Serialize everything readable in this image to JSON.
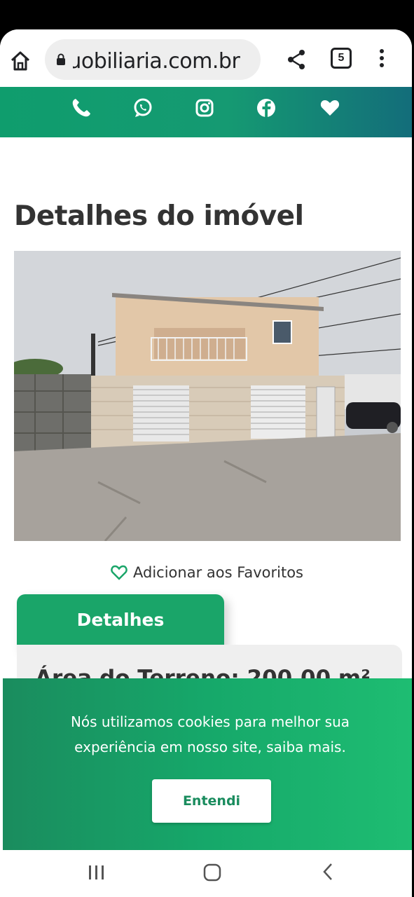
{
  "browser": {
    "url": "ɹobiliaria.com.br",
    "tab_count": "5",
    "icons": [
      "home-icon",
      "lock-icon",
      "share-icon",
      "tabs-icon",
      "more-vert-icon"
    ]
  },
  "social_bar": {
    "icons": [
      "phone-icon",
      "whatsapp-icon",
      "instagram-icon",
      "facebook-icon",
      "heart-icon"
    ],
    "color": "#159a72"
  },
  "page": {
    "title": "Detalhes do imóvel",
    "favorite_label": "Adicionar aos Favoritos",
    "tab_label": "Detalhes",
    "area_text": "Área do Terreno: 200,00 m²"
  },
  "cookie_banner": {
    "message": "Nós utilizamos cookies para melhor sua experiência em nosso site, saiba mais.",
    "button_label": "Entendi",
    "color": "#16a86a"
  },
  "system_nav": {
    "icons": [
      "recents-icon",
      "home-circle-icon",
      "back-icon"
    ]
  }
}
